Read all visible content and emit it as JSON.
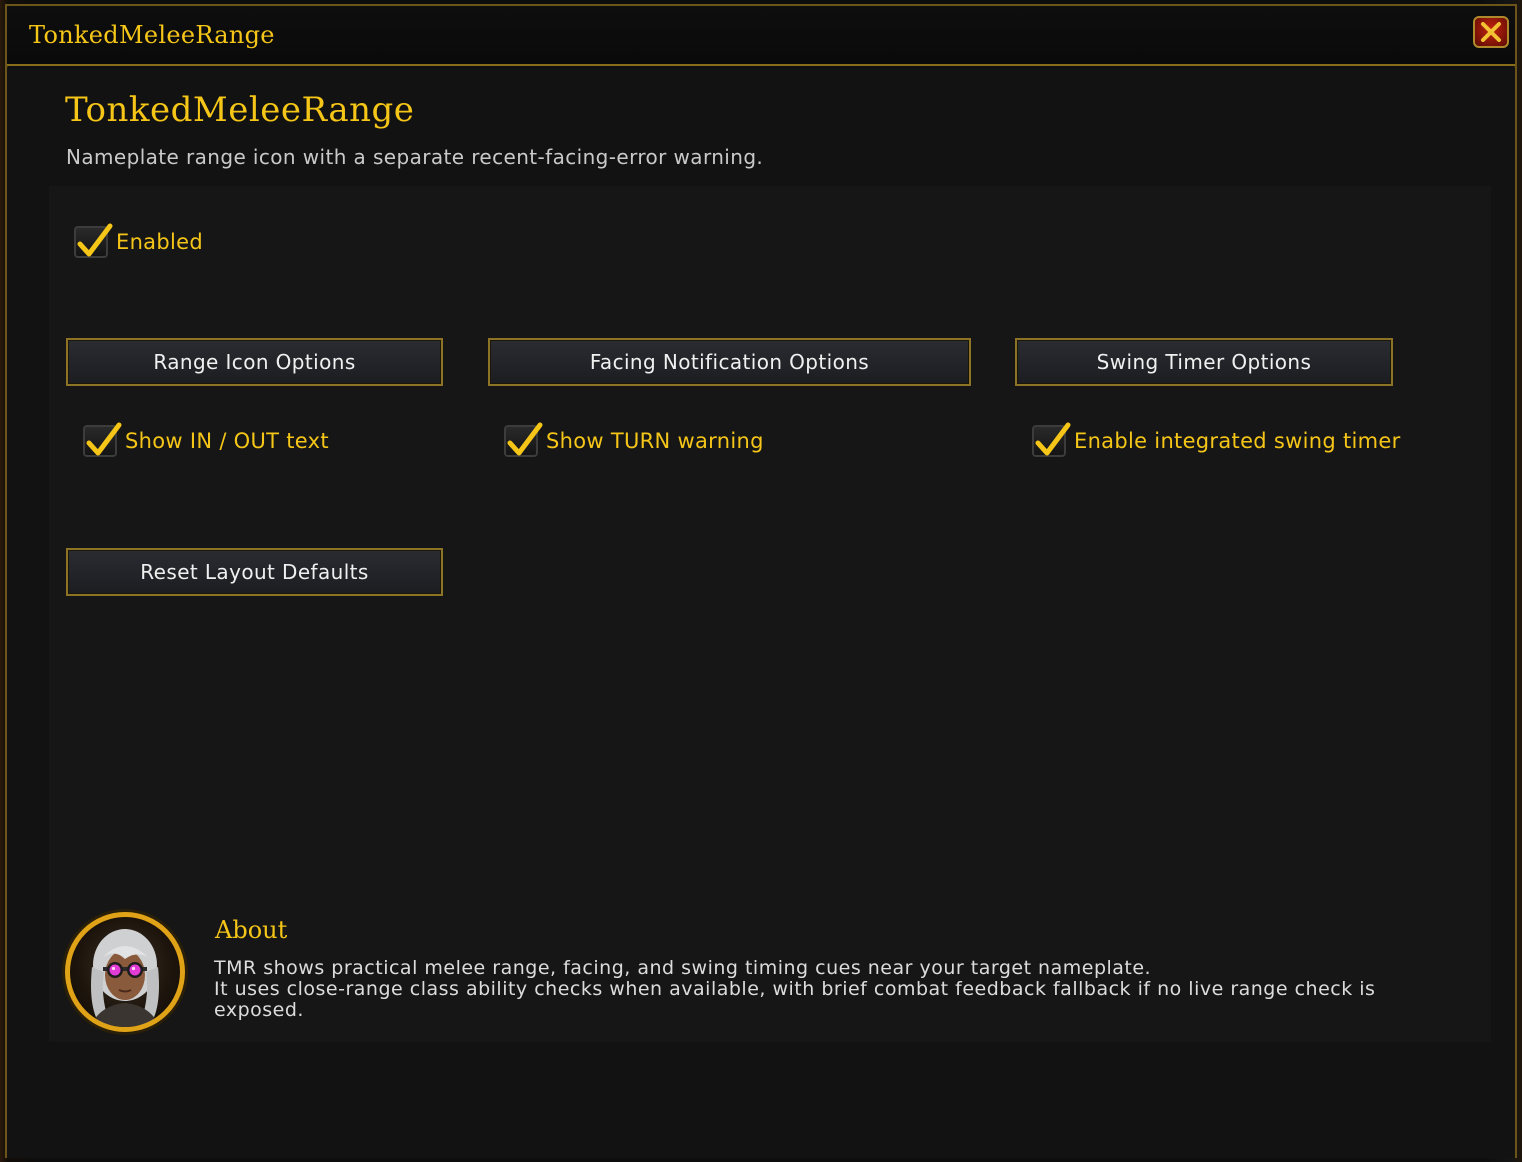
{
  "window": {
    "title": "TonkedMeleeRange",
    "close_icon": "close-x-icon"
  },
  "header": {
    "title": "TonkedMeleeRange",
    "subtitle": "Nameplate range icon with a separate recent-facing-error warning."
  },
  "options": {
    "enabled": {
      "label": "Enabled",
      "checked": true
    },
    "buttons": {
      "range_icon": "Range Icon Options",
      "facing": "Facing Notification Options",
      "swing_timer": "Swing Timer Options",
      "reset": "Reset Layout Defaults"
    },
    "checks": {
      "show_in_out": {
        "label": "Show IN / OUT text",
        "checked": true
      },
      "show_turn": {
        "label": "Show TURN warning",
        "checked": true
      },
      "swing_timer": {
        "label": "Enable integrated swing timer",
        "checked": true
      }
    }
  },
  "about": {
    "title": "About",
    "line1": "TMR shows practical melee range, facing, and swing timing cues near your target nameplate.",
    "line2": "It uses close-range class ability checks when available, with brief combat feedback fallback if no live range check is exposed."
  },
  "colors": {
    "accent_gold": "#f5c518",
    "border_gold": "#8c7326",
    "background": "#121212"
  }
}
